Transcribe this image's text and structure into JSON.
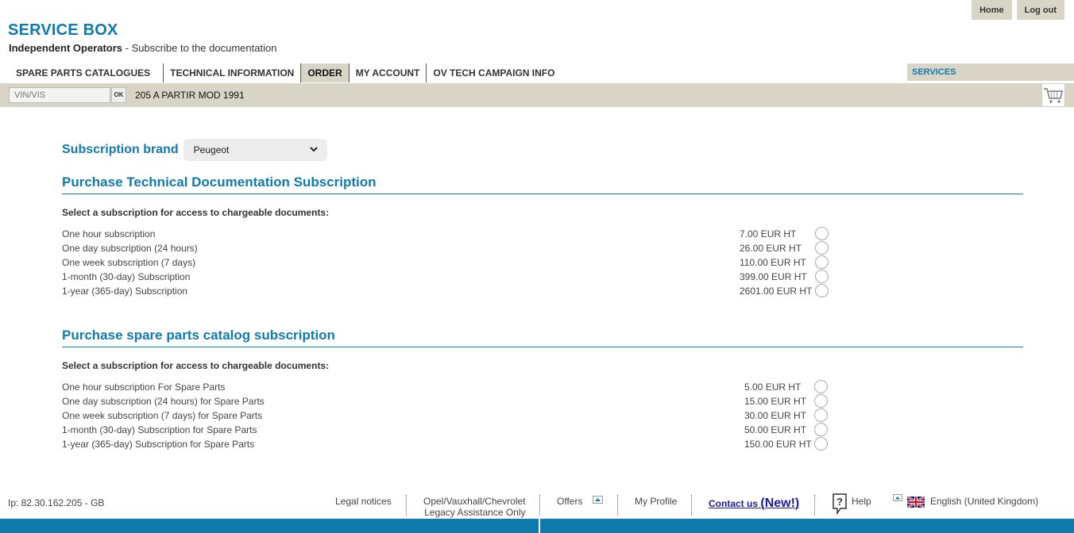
{
  "header": {
    "home_label": "Home",
    "logout_label": "Log out",
    "app_title": "SERVICE BOX",
    "subtitle_bold": "Independent Operators",
    "subtitle_rest": " - Subscribe to the documentation"
  },
  "nav": {
    "items": [
      "SPARE PARTS CATALOGUES",
      "TECHNICAL INFORMATION",
      "ORDER",
      "MY ACCOUNT",
      "OV TECH CAMPAIGN INFO"
    ],
    "active": "ORDER",
    "services_label": "SERVICES"
  },
  "search": {
    "placeholder": "VIN/VIS",
    "ok_label": "OK",
    "model": "205 A PARTIR MOD 1991"
  },
  "subscription": {
    "brand_label": "Subscription brand",
    "brand_selected": "Peugeot"
  },
  "tech_section": {
    "title": "Purchase Technical Documentation Subscription",
    "note": "Select a subscription for access to chargeable documents:",
    "options": [
      {
        "label": "One hour subscription",
        "price": "7.00 EUR HT"
      },
      {
        "label": "One day subscription (24 hours)",
        "price": "26.00 EUR HT"
      },
      {
        "label": "One week subscription (7 days)",
        "price": "110.00 EUR HT"
      },
      {
        "label": "1-month (30-day) Subscription",
        "price": "399.00 EUR HT"
      },
      {
        "label": "1-year (365-day) Subscription",
        "price": "2601.00 EUR HT"
      }
    ]
  },
  "parts_section": {
    "title": "Purchase spare parts catalog subscription",
    "note": "Select a subscription for access to chargeable documents:",
    "options": [
      {
        "label": "One hour subscription For Spare Parts",
        "price": "5.00 EUR HT"
      },
      {
        "label": "One day subscription (24 hours) for Spare Parts",
        "price": "15.00 EUR HT"
      },
      {
        "label": "One week subscription (7 days) for Spare Parts",
        "price": "30.00 EUR HT"
      },
      {
        "label": "1-month (30-day) Subscription for Spare Parts",
        "price": "50.00 EUR HT"
      },
      {
        "label": "1-year (365-day) Subscription for Spare Parts",
        "price": "150.00 EUR HT"
      }
    ]
  },
  "footer": {
    "ip": "Ip: 82.30.162.205 - GB",
    "legal": "Legal notices",
    "legacy_line1": "Opel/Vauxhall/Chevrolet",
    "legacy_line2": "Legacy Assistance Only",
    "offers": "Offers",
    "profile": "My Profile",
    "contact": "Contact us",
    "contact_new": "(New!)",
    "help": "Help",
    "language": "English (United Kingdom)"
  },
  "colors": {
    "brand_blue": "#0f7aad",
    "bar_beige": "#d8d5c7"
  },
  "icons": [
    "chevron-down-icon",
    "cart-icon",
    "help-icon",
    "arrow-up-icon",
    "uk-flag-icon"
  ]
}
